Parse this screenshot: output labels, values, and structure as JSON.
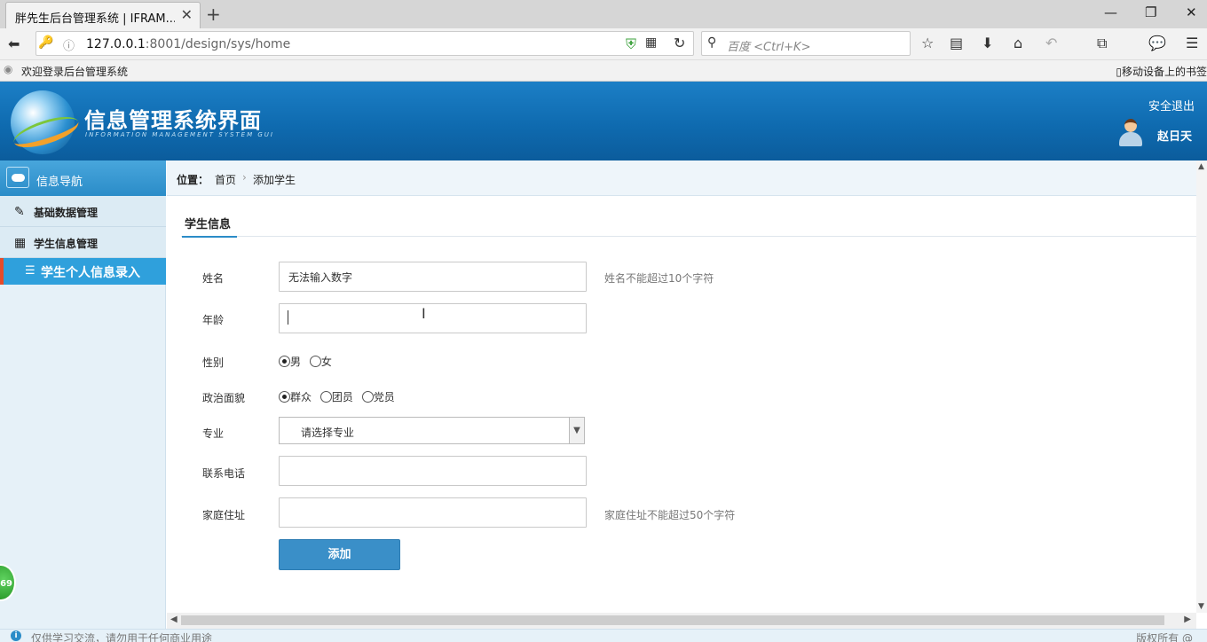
{
  "browser": {
    "tab_title": "胖先生后台管理系统 | IFRAM...",
    "tab_close": "✕",
    "new_tab": "+",
    "url_host": "127.0.0.1",
    "url_rest": ":8001/design/sys/home",
    "search_placeholder": "百度 <Ctrl+K>",
    "bookmark_item": "欢迎登录后台管理系统",
    "mobile_bookmarks": "移动设备上的书签"
  },
  "header": {
    "title": "信息管理系统界面",
    "subtitle": "INFORMATION MANAGEMENT SYSTEM GUI",
    "logout": "安全退出",
    "username": "赵日天"
  },
  "sidebar": {
    "head": "信息导航",
    "items": [
      {
        "label": "基础数据管理",
        "icon": "edit-icon"
      },
      {
        "label": "学生信息管理",
        "icon": "calendar-icon"
      }
    ],
    "active": {
      "label": "学生个人信息录入",
      "icon": "list-icon"
    }
  },
  "breadcrumb": {
    "label": "位置：",
    "home": "首页",
    "sep": "›",
    "current": "添加学生"
  },
  "section": {
    "title": "学生信息"
  },
  "form": {
    "name": {
      "label": "姓名",
      "value": "无法输入数字",
      "hint": "姓名不能超过10个字符"
    },
    "age": {
      "label": "年龄",
      "value": ""
    },
    "gender": {
      "label": "性别",
      "options": [
        "男",
        "女"
      ],
      "selected": "男"
    },
    "political": {
      "label": "政治面貌",
      "options": [
        "群众",
        "团员",
        "党员"
      ],
      "selected": "群众"
    },
    "major": {
      "label": "专业",
      "value": "请选择专业"
    },
    "phone": {
      "label": "联系电话",
      "value": ""
    },
    "address": {
      "label": "家庭住址",
      "value": "",
      "hint": "家庭住址不能超过50个字符"
    },
    "submit": "添加"
  },
  "footer": {
    "left": "仅供学习交流，请勿用于任何商业用途",
    "right": "版权所有 @"
  },
  "badge": "69"
}
